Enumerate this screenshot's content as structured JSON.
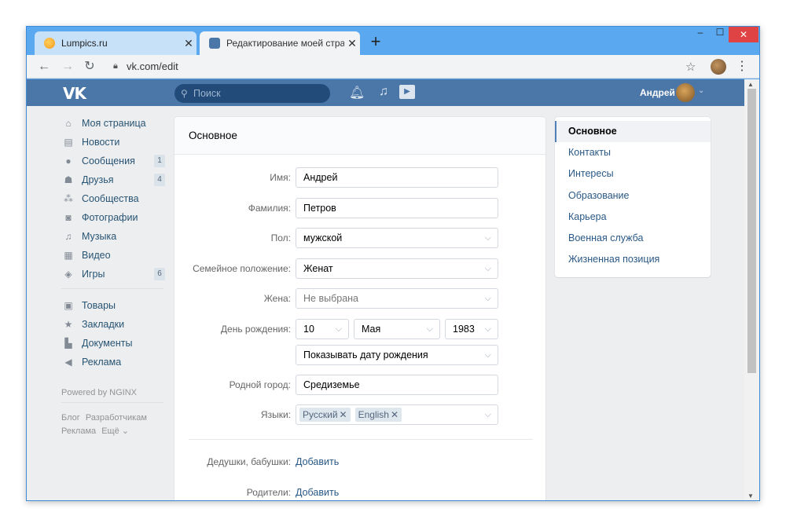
{
  "browser": {
    "tabs": [
      {
        "title": "Lumpics.ru",
        "close": "✕"
      },
      {
        "title": "Редактирование моей страниц",
        "close": "✕"
      }
    ],
    "new_tab": "+",
    "window_controls": {
      "minimize": "–",
      "maximize": "☐",
      "close": "✕"
    },
    "url": "vk.com/edit",
    "nav": {
      "back": "←",
      "forward": "→",
      "reload": "↻"
    },
    "star": "☆",
    "menu": "⋮"
  },
  "vk_header": {
    "logo": "VK",
    "search_placeholder": "Поиск",
    "user_name": "Андрей",
    "chevron": "⌄"
  },
  "left_nav": {
    "items": [
      {
        "label": "Моя страница",
        "icon": "home-icon",
        "badge": ""
      },
      {
        "label": "Новости",
        "icon": "news-icon",
        "badge": ""
      },
      {
        "label": "Сообщения",
        "icon": "messages-icon",
        "badge": "1"
      },
      {
        "label": "Друзья",
        "icon": "friends-icon",
        "badge": "4"
      },
      {
        "label": "Сообщества",
        "icon": "groups-icon",
        "badge": ""
      },
      {
        "label": "Фотографии",
        "icon": "photos-icon",
        "badge": ""
      },
      {
        "label": "Музыка",
        "icon": "music-icon",
        "badge": ""
      },
      {
        "label": "Видео",
        "icon": "video-icon",
        "badge": ""
      },
      {
        "label": "Игры",
        "icon": "games-icon",
        "badge": "6"
      },
      {
        "label": "Товары",
        "icon": "goods-icon",
        "badge": ""
      },
      {
        "label": "Закладки",
        "icon": "bookmarks-icon",
        "badge": ""
      },
      {
        "label": "Документы",
        "icon": "documents-icon",
        "badge": ""
      },
      {
        "label": "Реклама",
        "icon": "ads-icon",
        "badge": ""
      }
    ],
    "powered_by": "Powered by NGINX",
    "footer_links": [
      "Блог",
      "Разработчикам",
      "Реклама",
      "Ещё ⌄"
    ]
  },
  "form": {
    "title": "Основное",
    "fields": {
      "first_name": {
        "label": "Имя:",
        "value": "Андрей"
      },
      "last_name": {
        "label": "Фамилия:",
        "value": "Петров"
      },
      "gender": {
        "label": "Пол:",
        "value": "мужской"
      },
      "marital": {
        "label": "Семейное положение:",
        "value": "Женат"
      },
      "spouse": {
        "label": "Жена:",
        "value": "Не выбрана"
      },
      "birthday": {
        "label": "День рождения:",
        "day": "10",
        "month": "Мая",
        "year": "1983",
        "visibility": "Показывать дату рождения"
      },
      "hometown": {
        "label": "Родной город:",
        "value": "Средиземье"
      },
      "languages": {
        "label": "Языки:",
        "values": [
          "Русский",
          "English"
        ],
        "remove": "✕"
      }
    },
    "relatives": [
      {
        "label": "Дедушки, бабушки:",
        "action": "Добавить"
      },
      {
        "label": "Родители:",
        "action": "Добавить"
      }
    ]
  },
  "right_menu": {
    "items": [
      "Основное",
      "Контакты",
      "Интересы",
      "Образование",
      "Карьера",
      "Военная служба",
      "Жизненная позиция"
    ],
    "active": "Основное"
  },
  "colors": {
    "vk_blue": "#4a76a8",
    "link": "#2a5885",
    "chrome_frame": "#5aa9f0"
  }
}
